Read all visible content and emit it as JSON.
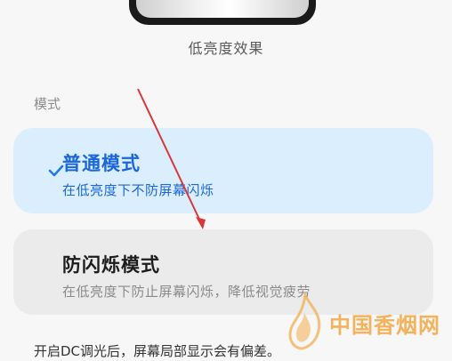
{
  "preview": {
    "caption": "低亮度效果"
  },
  "section": {
    "label": "模式"
  },
  "modes": [
    {
      "title": "普通模式",
      "desc": "在低亮度下不防屏幕闪烁",
      "selected": true
    },
    {
      "title": "防闪烁模式",
      "desc": "在低亮度下防止屏幕闪烁，降低视觉疲劳",
      "selected": false
    }
  ],
  "footer": {
    "text": "开启DC调光后，屏幕局部显示会有偏差。"
  },
  "watermark": {
    "text": "中国香烟网"
  },
  "colors": {
    "accent": "#1b66d8",
    "selected_bg": "#dbeefd",
    "card_bg": "#ebebeb",
    "annotation_arrow": "#d9373a"
  }
}
